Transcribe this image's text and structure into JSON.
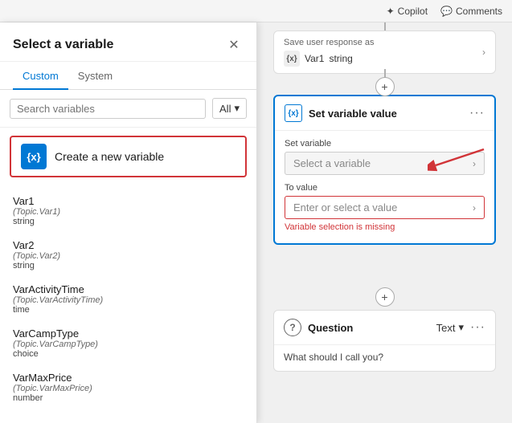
{
  "topbar": {
    "copilot_label": "Copilot",
    "comments_label": "Comments"
  },
  "panel": {
    "title": "Select a variable",
    "close_icon": "✕",
    "tabs": [
      {
        "id": "custom",
        "label": "Custom",
        "active": true
      },
      {
        "id": "system",
        "label": "System",
        "active": false
      }
    ],
    "search_placeholder": "Search variables",
    "filter_label": "All",
    "create_new": {
      "label": "Create a new variable",
      "icon": "{x}"
    },
    "variables": [
      {
        "name": "Var1",
        "topic": "(Topic.Var1)",
        "type": "string"
      },
      {
        "name": "Var2",
        "topic": "(Topic.Var2)",
        "type": "string"
      },
      {
        "name": "VarActivityTime",
        "topic": "(Topic.VarActivityTime)",
        "type": "time"
      },
      {
        "name": "VarCampType",
        "topic": "(Topic.VarCampType)",
        "type": "choice"
      },
      {
        "name": "VarMaxPrice",
        "topic": "(Topic.VarMaxPrice)",
        "type": "number"
      }
    ]
  },
  "canvas": {
    "save_response": {
      "label": "Save user response as",
      "var_icon": "{x}",
      "var_name": "Var1",
      "var_type": "string"
    },
    "set_var_card": {
      "title": "Set variable value",
      "icon": "{x}",
      "set_var_label": "Set variable",
      "set_var_placeholder": "Select a variable",
      "to_value_label": "To value",
      "to_value_placeholder": "Enter or select a value",
      "error_text": "Variable selection is missing"
    },
    "question_card": {
      "title": "Question",
      "type_label": "Text",
      "body_text": "What should I call you?"
    }
  },
  "icons": {
    "chevron_right": "›",
    "chevron_down": "⌄",
    "three_dots": "···",
    "plus": "+"
  }
}
